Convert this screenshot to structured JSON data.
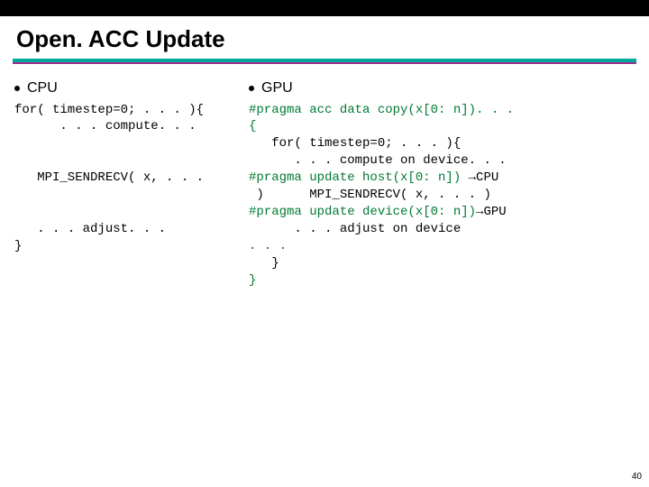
{
  "title": "Open. ACC Update",
  "left": {
    "bullet": "CPU",
    "code1": "for( timestep=0; . . . ){",
    "code2": "      . . . compute. . .",
    "code3": "   MPI_SENDRECV( x, . . .",
    "code4": "   . . . adjust. . .",
    "code5": "}"
  },
  "right": {
    "bullet": "GPU",
    "l1": "#pragma acc data copy(x[0: n]). . .",
    "l2": "{",
    "l3": "   for( timestep=0; . . . ){",
    "l4": "      . . . compute on device. . .",
    "l5a": "#pragma update host(x[0: n]) ",
    "l5arrow": "→",
    "l5b": "CPU",
    "l6a": " )",
    "l6b": "      MPI_SENDRECV( x, . . . )",
    "l7a": "#pragma update device(x[0: n])",
    "l7arrow": "→",
    "l7b": "GPU",
    "l8": "      . . . adjust on device",
    "l9": ". . .",
    "l10": "   }",
    "l11": "}"
  },
  "page": "40"
}
